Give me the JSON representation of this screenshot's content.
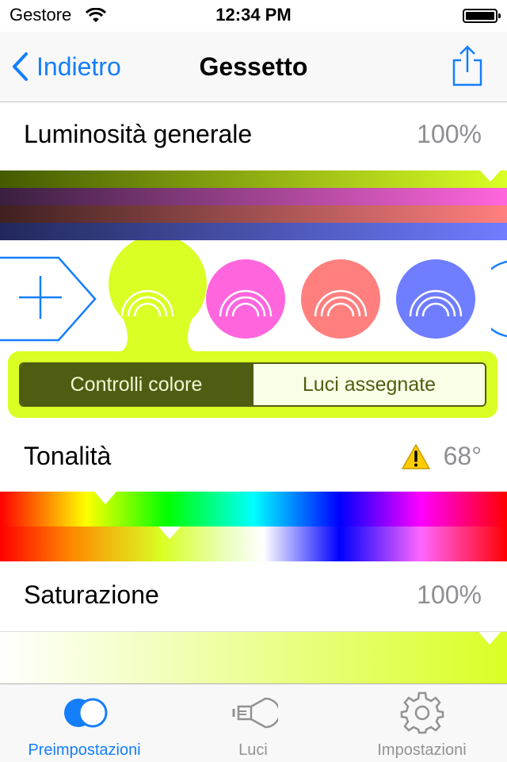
{
  "status_bar": {
    "carrier": "Gestore",
    "time": "12:34 PM"
  },
  "nav": {
    "back_label": "Indietro",
    "title": "Gessetto",
    "share_icon": "share-icon"
  },
  "brightness": {
    "label": "Luminosità generale",
    "value": "100%",
    "level": 1.0
  },
  "presets": {
    "add_icon": "plus-icon",
    "items": [
      {
        "color": "#d9ff24",
        "icon": "rainbow-icon",
        "selected": true
      },
      {
        "color": "#ff66dd",
        "icon": "rainbow-icon",
        "selected": false
      },
      {
        "color": "#ff7f7f",
        "icon": "rainbow-icon",
        "selected": false
      },
      {
        "color": "#6f7dff",
        "icon": "rainbow-icon",
        "selected": false
      }
    ]
  },
  "segmented": {
    "active_label": "Controlli colore",
    "inactive_label": "Luci assegnate"
  },
  "hue": {
    "label": "Tonalità",
    "value": "68°",
    "warning_icon": "warning-icon"
  },
  "saturation": {
    "label": "Saturazione",
    "value": "100%",
    "level": 1.0
  },
  "tabs": [
    {
      "label": "Preimpostazioni",
      "icon": "presets-icon",
      "selected": true
    },
    {
      "label": "Luci",
      "icon": "bulb-icon",
      "selected": false
    },
    {
      "label": "Impostazioni",
      "icon": "gear-icon",
      "selected": false
    }
  ],
  "colors": {
    "accent": "#157efb",
    "selected_preset": "#d9ff24",
    "segment_dark": "#4e5d12"
  }
}
